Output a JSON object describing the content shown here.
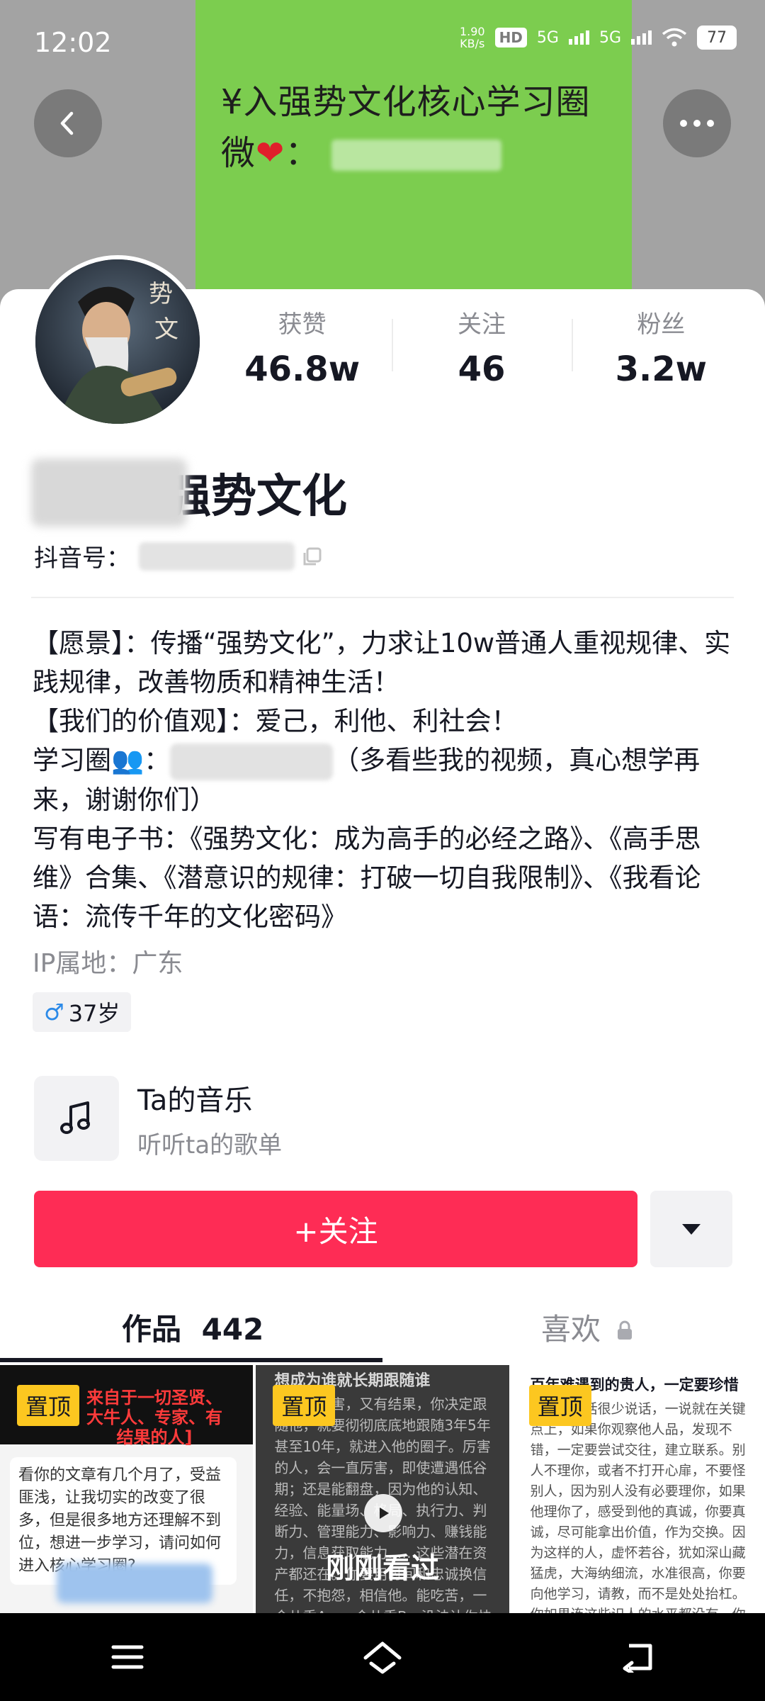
{
  "status_bar": {
    "time": "12:02",
    "net_speed_value": "1.90",
    "net_speed_unit": "KB/s",
    "hd_label": "HD",
    "signal_1": "5G",
    "signal_2": "5G",
    "battery": "77"
  },
  "banner": {
    "line1": "¥入强势文化核心学习圈",
    "line2_prefix": "微",
    "line2_suffix": "："
  },
  "stats": [
    {
      "label": "获赞",
      "value": "46.8w"
    },
    {
      "label": "关注",
      "value": "46"
    },
    {
      "label": "粉丝",
      "value": "3.2w"
    }
  ],
  "profile": {
    "name": "强势文化",
    "id_label": "抖音号："
  },
  "bio": {
    "line1": "【愿景】：传播“强势文化”，力求让10w普通人重视规律、实践规律，改善物质和精神生活！",
    "line2": "【我们的价值观】：爱己，利他、利社会！",
    "line3_prefix": "学习圈",
    "line3_suffix": "（多看些我的视频，真心想学再来，谢谢你们）",
    "line4": "写有电子书：《强势文化：成为高手的必经之路》、《高手思维》合集、《潜意识的规律：打破一切自我限制》、《我看论语：流传千年的文化密码》"
  },
  "ip": "IP属地：广东",
  "tag": {
    "symbol": "♂",
    "age": "37岁"
  },
  "music": {
    "title": "Ta的音乐",
    "subtitle": "听听ta的歌单"
  },
  "follow_button": "+关注",
  "tabs": {
    "works": "作品",
    "works_count": "442",
    "likes": "喜欢"
  },
  "grid": [
    {
      "pin": "置顶",
      "red_text": "来自于一切圣贤、大牛人、专家、有结果的人]",
      "bubble": "看你的文章有几个月了，受益匪浅，让我切实的改变了很多，但是很多地方还理解不到位，想进一步学习，请问如何进入核心学习圈?"
    },
    {
      "pin": "置顶",
      "heading": "想成为谁就长期跟随谁",
      "body": "真的很厉害，又有结果，你决定跟随他，就要彻彻底底地跟随3年5年甚至10年，就进入他的圈子。厉害的人，会一直厉害，即使遭遇低谷期；还是能翻盘，因为他的认知、经验、能量场、格局、执行力、判断力、管理能力、影响力、赚钱能力，信息获取能力……这些潜在资产都还在。你要用时间和忠诚换信任，不抱怨，相信他。能吃苦，一会儿乘A，一会儿乘B，没法让你快速赚钱。",
      "overlay": "刚刚看过"
    },
    {
      "pin": "置顶",
      "heading": "百年难遇到的贵人，一定要珍惜",
      "body": "贵人通常话很少说话，一说就在关键点上，如果你观察他人品，发现不错，一定要尝试交往，建立联系。别人不理你，或者不打开心扉，不要怪别人，因为别人没有必要理你，如果他理你了，感受到他的真诚，你要真诚，尽可能拿出价值，作为交换。因为这样的人，虚怀若谷，犹如深山藏猛虎，大海纳细流，水准很高，你要向他学习，请教，而不是处处抬杠。你如果连这些识人的水平都没有，你也就不配遇到贵人，你就按照自己套路走吧，能不能走出好的结果，全看你自己造化。"
    }
  ]
}
